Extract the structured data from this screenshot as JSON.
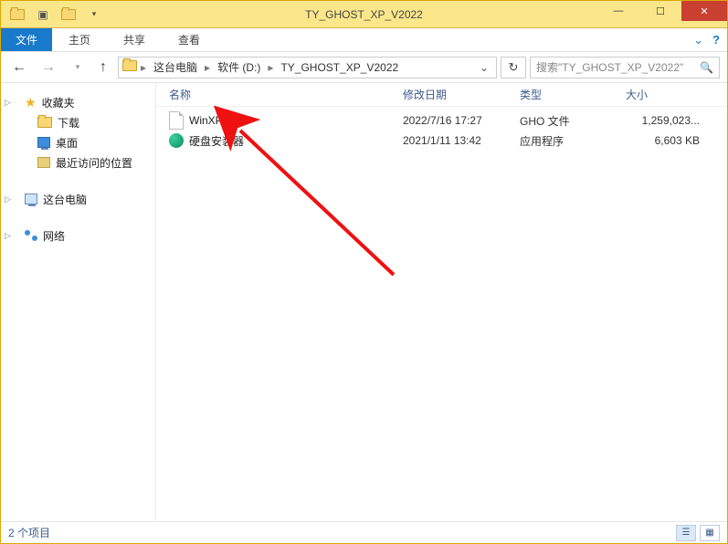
{
  "window": {
    "title": "TY_GHOST_XP_V2022"
  },
  "ribbon": {
    "file": "文件",
    "tabs": [
      "主页",
      "共享",
      "查看"
    ]
  },
  "nav": {
    "crumbs": [
      "这台电脑",
      "软件 (D:)",
      "TY_GHOST_XP_V2022"
    ],
    "search_placeholder": "搜索\"TY_GHOST_XP_V2022\""
  },
  "sidebar": {
    "favorites": {
      "label": "收藏夹",
      "items": [
        "下载",
        "桌面",
        "最近访问的位置"
      ]
    },
    "this_pc": "这台电脑",
    "network": "网络"
  },
  "columns": {
    "name": "名称",
    "date": "修改日期",
    "type": "类型",
    "size": "大小"
  },
  "files": [
    {
      "name": "WinXP.gho",
      "date": "2022/7/16 17:27",
      "type": "GHO 文件",
      "size": "1,259,023..."
    },
    {
      "name": "硬盘安装器",
      "date": "2021/1/11 13:42",
      "type": "应用程序",
      "size": "6,603 KB"
    }
  ],
  "status": {
    "count": "2 个项目"
  }
}
